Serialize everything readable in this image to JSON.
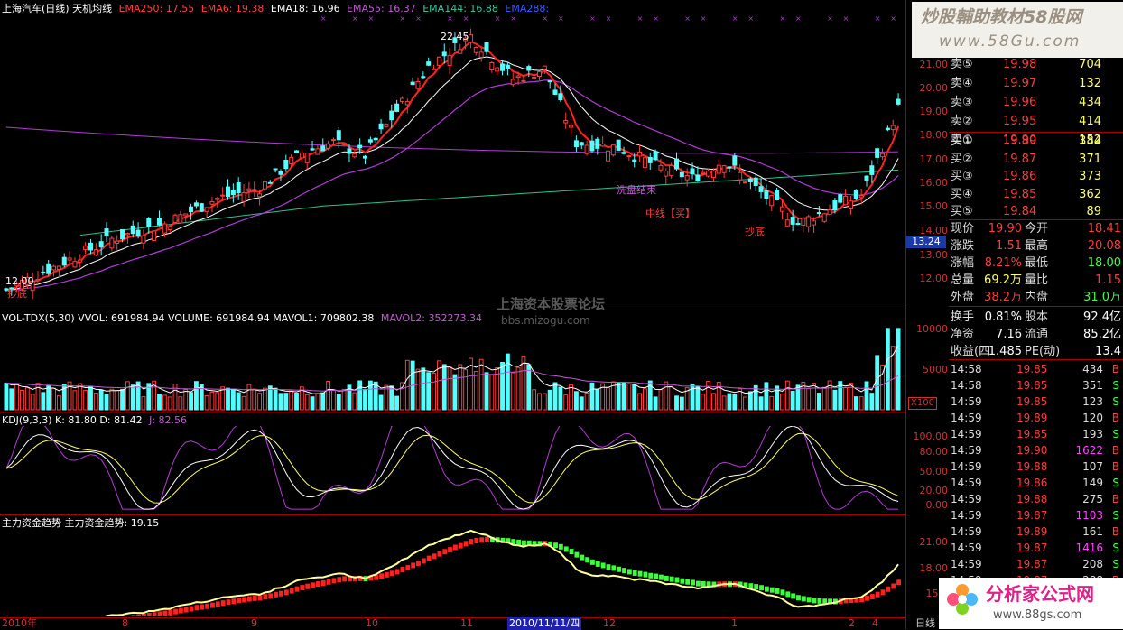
{
  "header": {
    "stock_title": "上海汽车(日线) 天机均线",
    "ema250": "EMA250: 17.55",
    "ema6": "EMA6: 19.38",
    "ema18": "EMA18: 16.96",
    "ema55": "EMA55: 16.37",
    "ema144": "EMA144: 16.88",
    "ema288": "EMA288:"
  },
  "main_chart": {
    "y_ticks": [
      "21.00",
      "20.00",
      "19.00",
      "18.00",
      "17.00",
      "16.00",
      "15.00",
      "14.00",
      "13.00",
      "12.00"
    ],
    "price_marker": "13.24",
    "annotations": {
      "high": "22.45",
      "low": "12.00",
      "buy_low": "抄底",
      "wash_end": "洗盘结束",
      "mid_buy": "中线【买】",
      "bottom": "抄底"
    },
    "watermark_center": "上海资本股票论坛",
    "watermark_url": "bbs.mizogu.com"
  },
  "volume_panel": {
    "title": "VOL-TDX(5,30) VVOL: 691984.94  VOLUME: 691984.94  MAVOL1: 709802.38",
    "mavol2": "MAVOL2: 352273.34",
    "y_ticks": [
      "10000",
      "5000"
    ],
    "unit": "X100"
  },
  "kdj_panel": {
    "title": "KDJ(9,3,3)  K: 81.80  D: 81.42",
    "j": "J: 82.56",
    "y_ticks": [
      "100.00",
      "80.00",
      "50.00",
      "20.00",
      "0.00"
    ]
  },
  "trend_panel": {
    "title": "主力资金趋势  主力资金趋势: 19.15",
    "y_ticks": [
      "21.00",
      "18.00",
      "15.0"
    ]
  },
  "x_axis": {
    "labels": [
      "2010年",
      "8",
      "9",
      "10",
      "11",
      "2010/11/11/四",
      "12",
      "1",
      "2",
      "4"
    ],
    "period": "日线"
  },
  "branding": {
    "top_logo": "炒股輔助教材58股网",
    "top_url": "www.58Gu.com",
    "bottom_logo": "分析家公式网",
    "bottom_url": "www.88gs.com"
  },
  "quote_panel": {
    "asks": [
      {
        "label": "卖⑤",
        "price": "19.98",
        "vol": "704"
      },
      {
        "label": "卖④",
        "price": "19.97",
        "vol": "132"
      },
      {
        "label": "卖③",
        "price": "19.96",
        "vol": "434"
      },
      {
        "label": "卖②",
        "price": "19.95",
        "vol": "414"
      },
      {
        "label": "卖①",
        "price": "19.90",
        "vol": "152"
      }
    ],
    "bids": [
      {
        "label": "买①",
        "price": "19.89",
        "vol": "384"
      },
      {
        "label": "买②",
        "price": "19.87",
        "vol": "371"
      },
      {
        "label": "买③",
        "price": "19.86",
        "vol": "373"
      },
      {
        "label": "买④",
        "price": "19.85",
        "vol": "362"
      },
      {
        "label": "买⑤",
        "price": "19.84",
        "vol": "89"
      }
    ],
    "stats": [
      {
        "l1": "现价",
        "v1": "19.90",
        "l2": "今开",
        "v2": "18.41",
        "c1": "#ff3b3b",
        "c2": "#ff3b3b"
      },
      {
        "l1": "涨跌",
        "v1": "1.51",
        "l2": "最高",
        "v2": "20.08",
        "c1": "#ff3b3b",
        "c2": "#ff3b3b"
      },
      {
        "l1": "涨幅",
        "v1": "8.21%",
        "l2": "最低",
        "v2": "18.00",
        "c1": "#ff3b3b",
        "c2": "#3cff3c"
      },
      {
        "l1": "总量",
        "v1": "69.2万",
        "l2": "量比",
        "v2": "1.15",
        "c1": "#ffff66",
        "c2": "#ff3b3b"
      },
      {
        "l1": "外盘",
        "v1": "38.2万",
        "l2": "内盘",
        "v2": "31.0万",
        "c1": "#ff3b3b",
        "c2": "#3cff3c"
      },
      {
        "l1": "换手",
        "v1": "0.81%",
        "l2": "股本",
        "v2": "92.4亿",
        "c1": "#ffffff",
        "c2": "#ffffff"
      },
      {
        "l1": "净资",
        "v1": "7.16",
        "l2": "流通",
        "v2": "85.2亿",
        "c1": "#ffffff",
        "c2": "#ffffff"
      },
      {
        "l1": "收益(四",
        "v1": "1.485",
        "l2": "PE(动)",
        "v2": "13.4",
        "c1": "#ffffff",
        "c2": "#ffffff"
      }
    ],
    "ticks": [
      {
        "time": "14:58",
        "price": "19.85",
        "vol": "434",
        "side": "B"
      },
      {
        "time": "14:58",
        "price": "19.85",
        "vol": "351",
        "side": "S"
      },
      {
        "time": "14:59",
        "price": "19.85",
        "vol": "123",
        "side": "S"
      },
      {
        "time": "14:59",
        "price": "19.89",
        "vol": "120",
        "side": "B"
      },
      {
        "time": "14:59",
        "price": "19.85",
        "vol": "193",
        "side": "S"
      },
      {
        "time": "14:59",
        "price": "19.90",
        "vol": "1622",
        "side": "B"
      },
      {
        "time": "14:59",
        "price": "19.88",
        "vol": "107",
        "side": "B"
      },
      {
        "time": "14:59",
        "price": "19.86",
        "vol": "149",
        "side": "S"
      },
      {
        "time": "14:59",
        "price": "19.88",
        "vol": "275",
        "side": "B"
      },
      {
        "time": "14:59",
        "price": "19.87",
        "vol": "1103",
        "side": "S"
      },
      {
        "time": "14:59",
        "price": "19.89",
        "vol": "161",
        "side": "B"
      },
      {
        "time": "14:59",
        "price": "19.87",
        "vol": "1416",
        "side": "S"
      },
      {
        "time": "14:59",
        "price": "19.87",
        "vol": "208",
        "side": "S"
      },
      {
        "time": "14:59",
        "price": "19.87",
        "vol": "288",
        "side": "B"
      }
    ]
  },
  "colors": {
    "up": "#ff3b3b",
    "down": "#54ffff",
    "axis": "#aa0000",
    "ema_white": "#ffffff",
    "ema_purple": "#b23bd6",
    "ema_green": "#3cc3a0",
    "ema_red": "#ff2020"
  }
}
